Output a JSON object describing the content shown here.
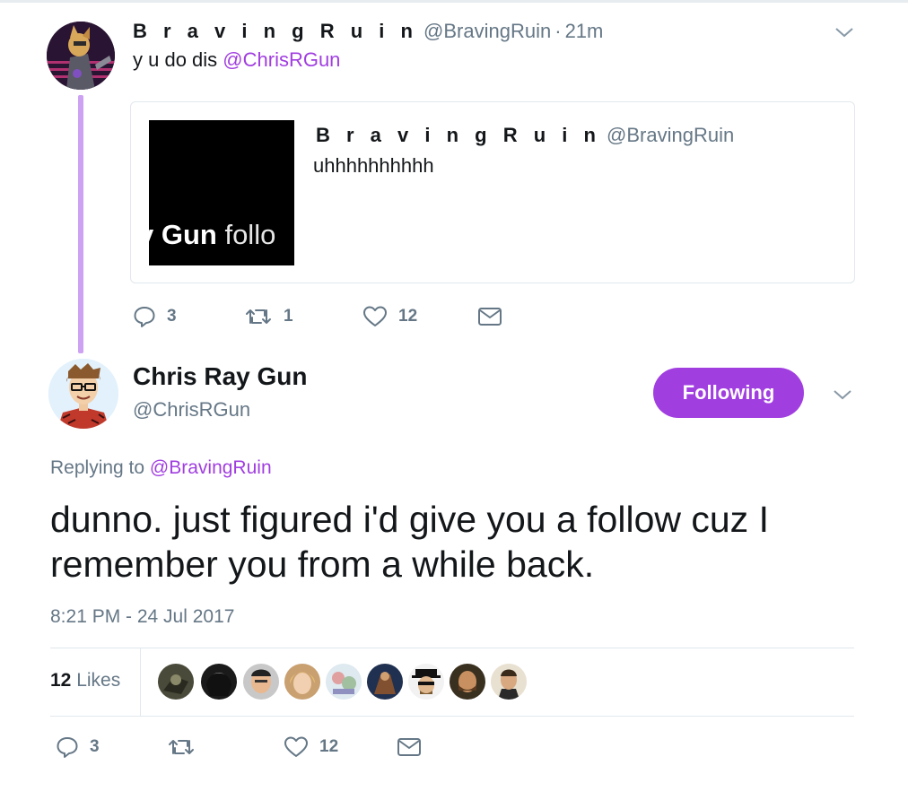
{
  "parent_tweet": {
    "display_name": "B r a v i n g R u i n",
    "handle": "@BravingRuin",
    "separator": "·",
    "time_ago": "21m",
    "text_prefix": "y u do dis ",
    "mention": "@ChrisRGun",
    "quoted_tweet": {
      "display_name": "B r a v i n g R u i n",
      "handle": "@BravingRuin",
      "text": "uhhhhhhhhhh",
      "media_text_bold": "y Gun",
      "media_text_rest": " follo"
    },
    "actions": {
      "replies": "3",
      "retweets": "1",
      "likes": "12"
    }
  },
  "main_tweet": {
    "display_name": "Chris Ray Gun",
    "handle": "@ChrisRGun",
    "follow_button_label": "Following",
    "replying_prefix": "Replying to ",
    "replying_to": "@BravingRuin",
    "text": "dunno. just figured i'd give you a follow cuz I remember you from a while back.",
    "timestamp": "8:21 PM - 24 Jul 2017",
    "likes_count": "12",
    "likes_label": " Likes",
    "liker_avatars": [
      "liker-avatar-1",
      "liker-avatar-2",
      "liker-avatar-3",
      "liker-avatar-4",
      "liker-avatar-5",
      "liker-avatar-6",
      "liker-avatar-7",
      "liker-avatar-8",
      "liker-avatar-9"
    ],
    "actions": {
      "replies": "3",
      "likes": "12"
    }
  },
  "colors": {
    "accent": "#a13ee0",
    "thread_line": "#cda2f2",
    "secondary_text": "#657786",
    "divider": "#e1e8ed"
  },
  "icons": [
    "chevron-down-icon",
    "reply-icon",
    "retweet-icon",
    "heart-icon",
    "direct-message-icon"
  ]
}
